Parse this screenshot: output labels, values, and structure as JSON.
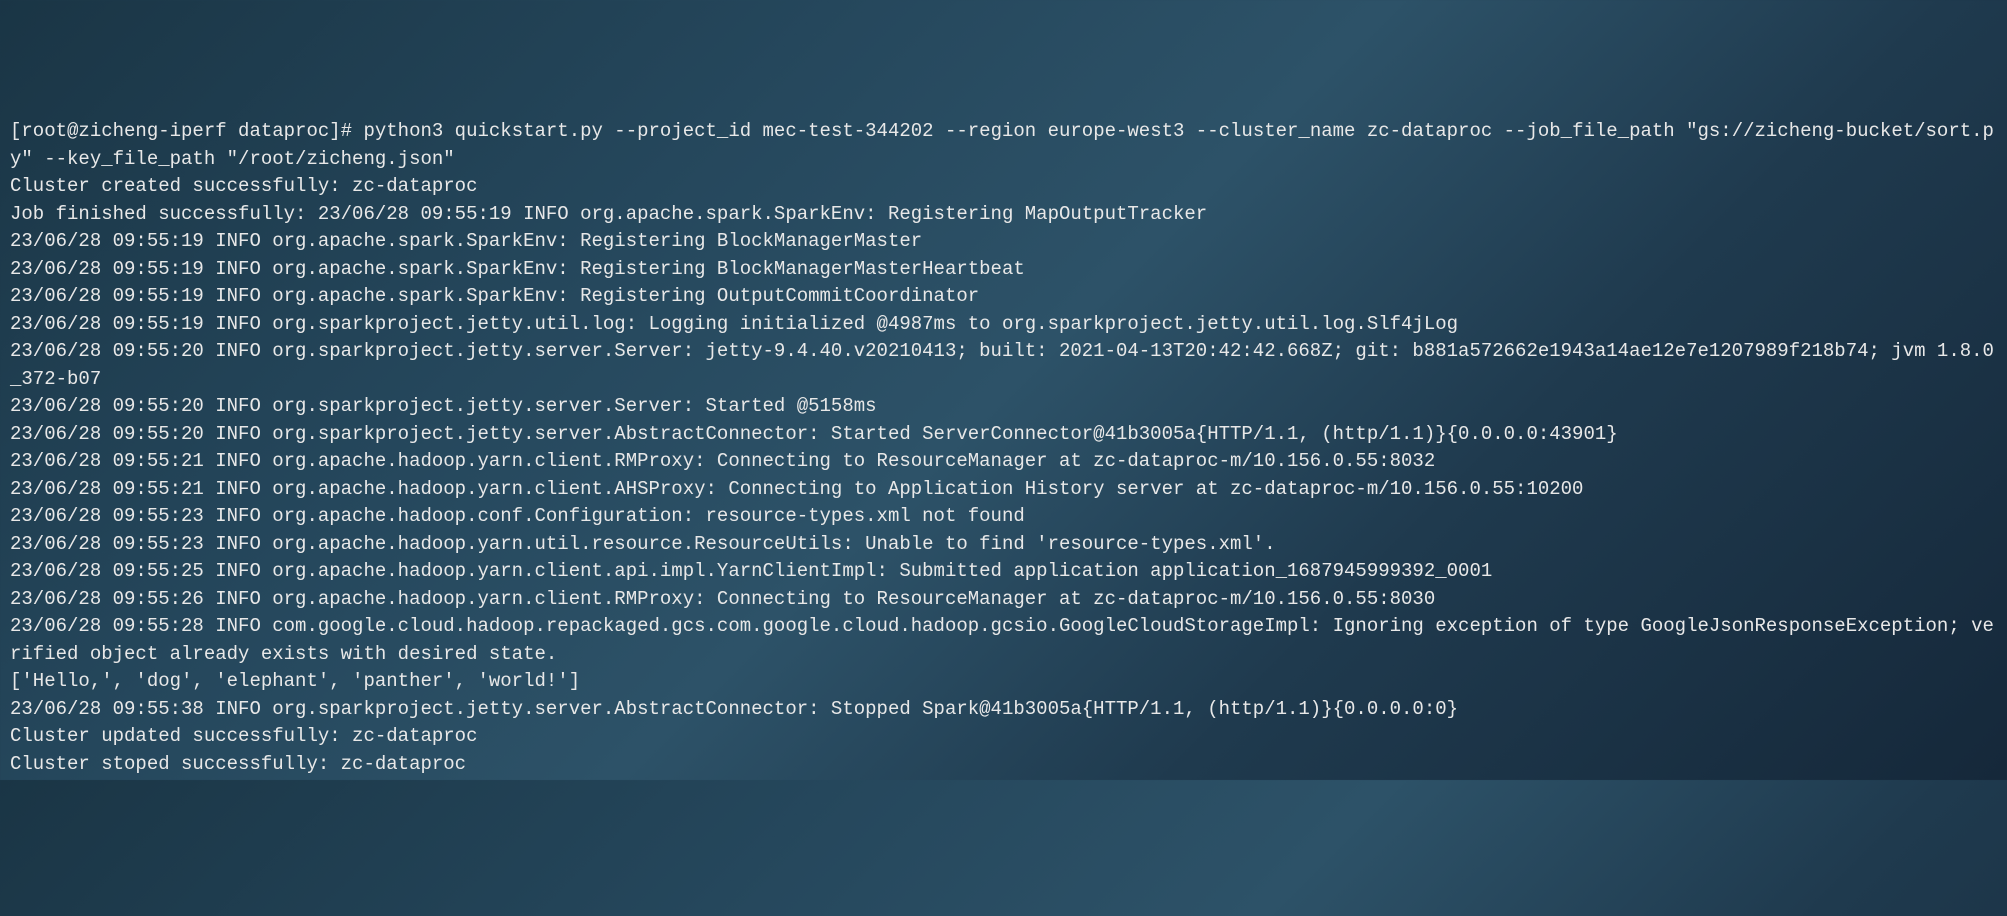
{
  "terminal": {
    "prompt": "[root@zicheng-iperf dataproc]# ",
    "command": "python3 quickstart.py --project_id mec-test-344202 --region europe-west3 --cluster_name zc-dataproc --job_file_path \"gs://zicheng-bucket/sort.py\" --key_file_path \"/root/zicheng.json\"",
    "lines": [
      "Cluster created successfully: zc-dataproc",
      "Job finished successfully: 23/06/28 09:55:19 INFO org.apache.spark.SparkEnv: Registering MapOutputTracker",
      "23/06/28 09:55:19 INFO org.apache.spark.SparkEnv: Registering BlockManagerMaster",
      "23/06/28 09:55:19 INFO org.apache.spark.SparkEnv: Registering BlockManagerMasterHeartbeat",
      "23/06/28 09:55:19 INFO org.apache.spark.SparkEnv: Registering OutputCommitCoordinator",
      "23/06/28 09:55:19 INFO org.sparkproject.jetty.util.log: Logging initialized @4987ms to org.sparkproject.jetty.util.log.Slf4jLog",
      "23/06/28 09:55:20 INFO org.sparkproject.jetty.server.Server: jetty-9.4.40.v20210413; built: 2021-04-13T20:42:42.668Z; git: b881a572662e1943a14ae12e7e1207989f218b74; jvm 1.8.0_372-b07",
      "23/06/28 09:55:20 INFO org.sparkproject.jetty.server.Server: Started @5158ms",
      "23/06/28 09:55:20 INFO org.sparkproject.jetty.server.AbstractConnector: Started ServerConnector@41b3005a{HTTP/1.1, (http/1.1)}{0.0.0.0:43901}",
      "23/06/28 09:55:21 INFO org.apache.hadoop.yarn.client.RMProxy: Connecting to ResourceManager at zc-dataproc-m/10.156.0.55:8032",
      "23/06/28 09:55:21 INFO org.apache.hadoop.yarn.client.AHSProxy: Connecting to Application History server at zc-dataproc-m/10.156.0.55:10200",
      "23/06/28 09:55:23 INFO org.apache.hadoop.conf.Configuration: resource-types.xml not found",
      "23/06/28 09:55:23 INFO org.apache.hadoop.yarn.util.resource.ResourceUtils: Unable to find 'resource-types.xml'.",
      "23/06/28 09:55:25 INFO org.apache.hadoop.yarn.client.api.impl.YarnClientImpl: Submitted application application_1687945999392_0001",
      "23/06/28 09:55:26 INFO org.apache.hadoop.yarn.client.RMProxy: Connecting to ResourceManager at zc-dataproc-m/10.156.0.55:8030",
      "23/06/28 09:55:28 INFO com.google.cloud.hadoop.repackaged.gcs.com.google.cloud.hadoop.gcsio.GoogleCloudStorageImpl: Ignoring exception of type GoogleJsonResponseException; verified object already exists with desired state.",
      "['Hello,', 'dog', 'elephant', 'panther', 'world!']",
      "23/06/28 09:55:38 INFO org.sparkproject.jetty.server.AbstractConnector: Stopped Spark@41b3005a{HTTP/1.1, (http/1.1)}{0.0.0.0:0}",
      "",
      "Cluster updated successfully: zc-dataproc",
      "Cluster stoped successfully: zc-dataproc"
    ]
  }
}
